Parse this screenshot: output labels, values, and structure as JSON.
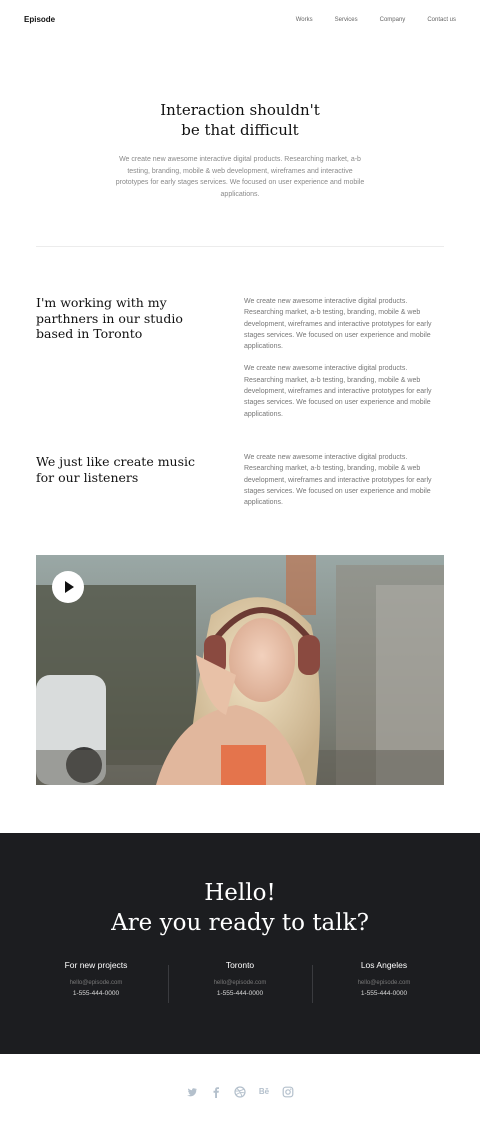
{
  "header": {
    "logo": "Episode",
    "nav": [
      "Works",
      "Services",
      "Company",
      "Contact us"
    ]
  },
  "hero": {
    "title_line1": "Interaction shouldn't",
    "title_line2": "be that difficult",
    "text": "We create new awesome interactive digital products. Researching market, a-b testing, branding, mobile & web development, wireframes and interactive prototypes for early stages services. We focused on user experience and mobile applications."
  },
  "studio": {
    "heading": "I'm working with my parthners in our studio based in Toronto",
    "paragraphs": [
      "We create new awesome interactive digital products. Researching market, a-b testing, branding, mobile & web development, wireframes and interactive prototypes for early stages services. We focused on user experience and mobile applications.",
      "We create new awesome interactive digital products. Researching market, a-b testing, branding, mobile & web development, wireframes and interactive prototypes for early stages services. We focused on user experience and mobile applications."
    ]
  },
  "music": {
    "heading": "We just like create music for our listeners",
    "paragraph": "We create new awesome interactive digital products. Researching market, a-b testing, branding, mobile & web development, wireframes and interactive prototypes for early stages services. We focused on user experience and mobile applications."
  },
  "video": {
    "play_icon": "play-icon"
  },
  "contact": {
    "title_line1": "Hello!",
    "title_line2": "Are you ready to talk?",
    "offices": [
      {
        "name": "For new projects",
        "email": "hello@episode.com",
        "phone": "1-555-444-0000"
      },
      {
        "name": "Toronto",
        "email": "hello@episode.com",
        "phone": "1-555-444-0000"
      },
      {
        "name": "Los Angeles",
        "email": "hello@episode.com",
        "phone": "1-555-444-0000"
      }
    ]
  },
  "footer": {
    "social_icons": [
      "twitter-icon",
      "facebook-icon",
      "dribbble-icon",
      "behance-icon",
      "instagram-icon"
    ],
    "behance_text": "Bē"
  }
}
